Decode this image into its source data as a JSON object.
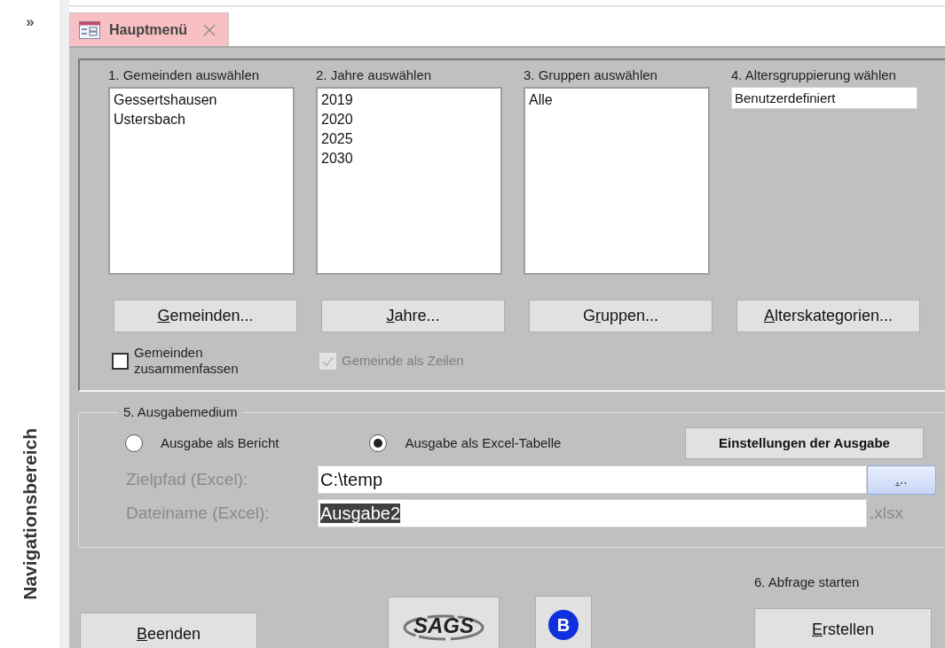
{
  "nav_pane": {
    "toggle": "»",
    "title": "Navigationsbereich"
  },
  "tabs": [
    {
      "label": "Hauptmenü",
      "selected": true
    }
  ],
  "selection_columns": [
    {
      "label": "1. Gemeinden auswählen",
      "kind": "list",
      "items": [
        "Gessertshausen",
        "Ustersbach"
      ],
      "button": [
        {
          "text": "G",
          "underlined": true
        },
        {
          "text": "emeinden...",
          "underlined": false
        }
      ]
    },
    {
      "label": "2. Jahre auswählen",
      "kind": "list",
      "items": [
        "2019",
        "2020",
        "2025",
        "2030"
      ],
      "button": [
        {
          "text": "J",
          "underlined": true
        },
        {
          "text": "ahre...",
          "underlined": false
        }
      ]
    },
    {
      "label": "3. Gruppen auswählen",
      "kind": "list",
      "items": [
        "Alle"
      ],
      "button": [
        {
          "text": "G",
          "underlined": false
        },
        {
          "text": "r",
          "underlined": true
        },
        {
          "text": "uppen...",
          "underlined": false
        }
      ]
    },
    {
      "label": "4. Altersgruppierung wählen",
      "kind": "field",
      "value": "Benutzerdefiniert",
      "button": [
        {
          "text": "A",
          "underlined": true
        },
        {
          "text": "lterskategorien...",
          "underlined": false
        }
      ]
    }
  ],
  "options": [
    {
      "label": "Gemeinden zusammenfassen",
      "checked": false,
      "disabled": false
    },
    {
      "label": "Gemeinde als Zeilen",
      "checked": true,
      "disabled": true
    }
  ],
  "output": {
    "legend": "5. Ausgabemedium",
    "radios": [
      {
        "label": "Ausgabe als Bericht",
        "selected": false
      },
      {
        "label": "Ausgabe als Excel-Tabelle",
        "selected": true
      }
    ],
    "settings_button": "Einstellungen der Ausgabe",
    "path": {
      "label": "Zielpfad (Excel):",
      "value": "C:\\temp",
      "browse": [
        {
          "text": ".",
          "underlined": true
        },
        {
          "text": "..",
          "underlined": false
        }
      ]
    },
    "filename": {
      "label": "Dateiname (Excel):",
      "value": "Ausgabe2",
      "value_selected": true,
      "suffix": ".xlsx"
    }
  },
  "footer": {
    "start_label": "6. Abfrage starten",
    "buttons": [
      {
        "kind": "text",
        "parts": [
          {
            "text": "B",
            "underlined": true
          },
          {
            "text": "eenden",
            "underlined": false
          }
        ]
      },
      {
        "kind": "sags-logo",
        "text": "SAGS"
      },
      {
        "kind": "b-logo",
        "text": "B"
      },
      {
        "kind": "text",
        "parts": [
          {
            "text": "E",
            "underlined": true
          },
          {
            "text": "rstellen",
            "underlined": false
          }
        ]
      }
    ]
  }
}
